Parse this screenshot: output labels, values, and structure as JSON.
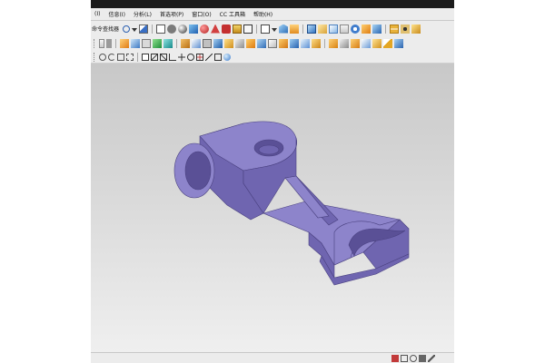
{
  "menu": {
    "items": [
      "(I)",
      "信息(I)",
      "分析(L)",
      "首选项(P)",
      "窗口(O)",
      "CC 工具箱",
      "帮助(H)"
    ]
  },
  "toolbar1": {
    "left_label": "命令查找器"
  },
  "icons": {
    "menu_search": "magnifier-icon",
    "viewport_part": "bracket-part-3d",
    "status": [
      "snap-icon",
      "grid-icon",
      "selection-filter-icon",
      "lock-icon",
      "wrench-icon"
    ]
  },
  "colors": {
    "part_top": "#8d84cb",
    "part_side": "#6f65b0",
    "part_dark": "#5a5096",
    "viewport_top": "#c8c8c8",
    "viewport_bottom": "#efefef"
  }
}
